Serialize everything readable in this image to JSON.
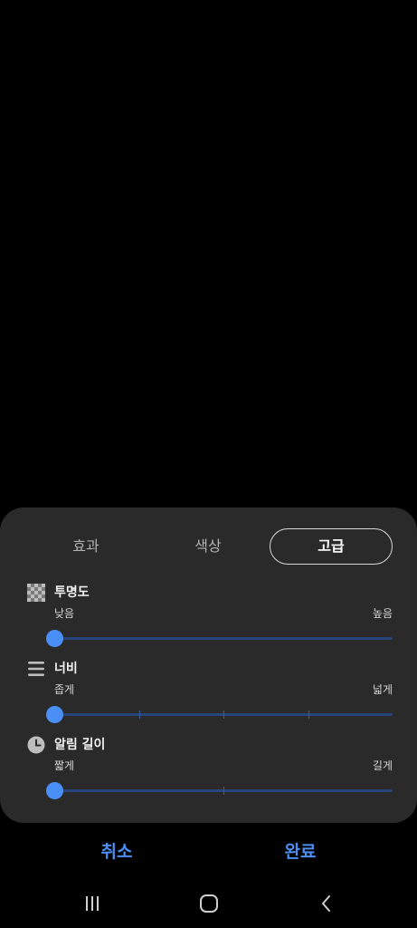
{
  "tabs": [
    {
      "label": "효과",
      "selected": false
    },
    {
      "label": "색상",
      "selected": false
    },
    {
      "label": "고급",
      "selected": true
    }
  ],
  "settings": {
    "opacity": {
      "title": "투명도",
      "min_label": "낮음",
      "max_label": "높음",
      "icon": "checkerboard-icon",
      "value": 0,
      "steps": 0
    },
    "width": {
      "title": "너비",
      "min_label": "좁게",
      "max_label": "넓게",
      "icon": "lines-icon",
      "value": 0,
      "steps": 4
    },
    "duration": {
      "title": "알림 길이",
      "min_label": "짧게",
      "max_label": "길게",
      "icon": "clock-icon",
      "value": 0,
      "steps": 2
    }
  },
  "actions": {
    "cancel": "취소",
    "done": "완료"
  },
  "navbar": {
    "recent": "recent-apps-icon",
    "home": "home-icon",
    "back": "back-icon"
  },
  "colors": {
    "accent": "#4a8ff5",
    "panel": "#2a2a2a",
    "track": "#27457a",
    "action_text": "#4c8ef2"
  }
}
